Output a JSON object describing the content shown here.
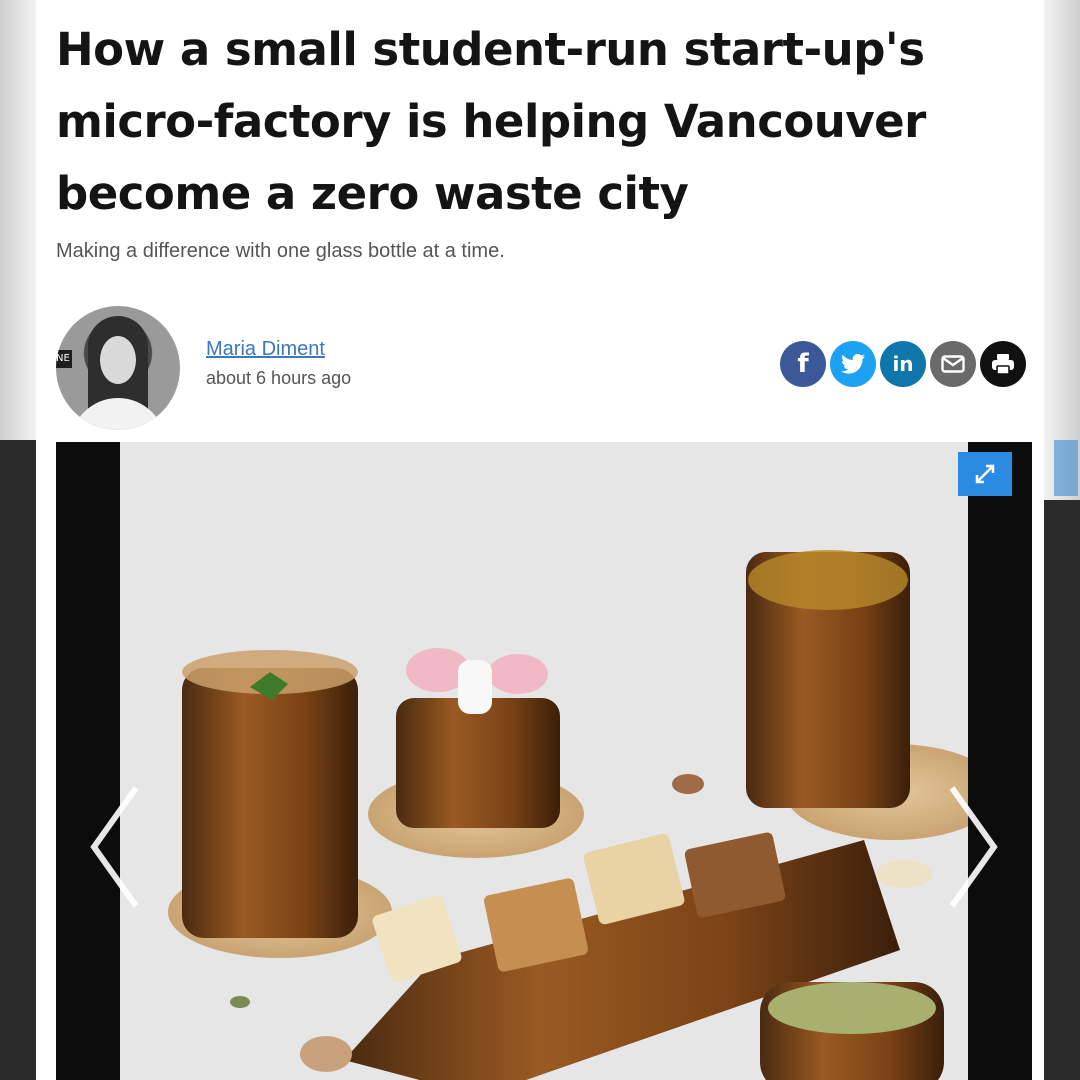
{
  "article": {
    "headline": "How a small student-run start-up's micro-factory is helping Vancouver become a zero waste city",
    "subtitle": "Making a difference with one glass bottle at a time."
  },
  "author": {
    "name": "Maria Diment",
    "time": "about 6 hours ago",
    "avatar_tag": "NE"
  },
  "share": {
    "buttons": [
      {
        "name": "facebook",
        "color": "#3b5998"
      },
      {
        "name": "twitter",
        "color": "#1da1f2"
      },
      {
        "name": "linkedin",
        "color": "#0e76a8"
      },
      {
        "name": "email",
        "color": "#6a6a6a"
      },
      {
        "name": "print",
        "color": "#111111"
      }
    ],
    "facebook_glyph": "f",
    "linkedin_glyph": "in"
  },
  "gallery": {
    "expand_icon": "expand-icon",
    "prev_icon": "chevron-left-icon",
    "next_icon": "chevron-right-icon"
  }
}
